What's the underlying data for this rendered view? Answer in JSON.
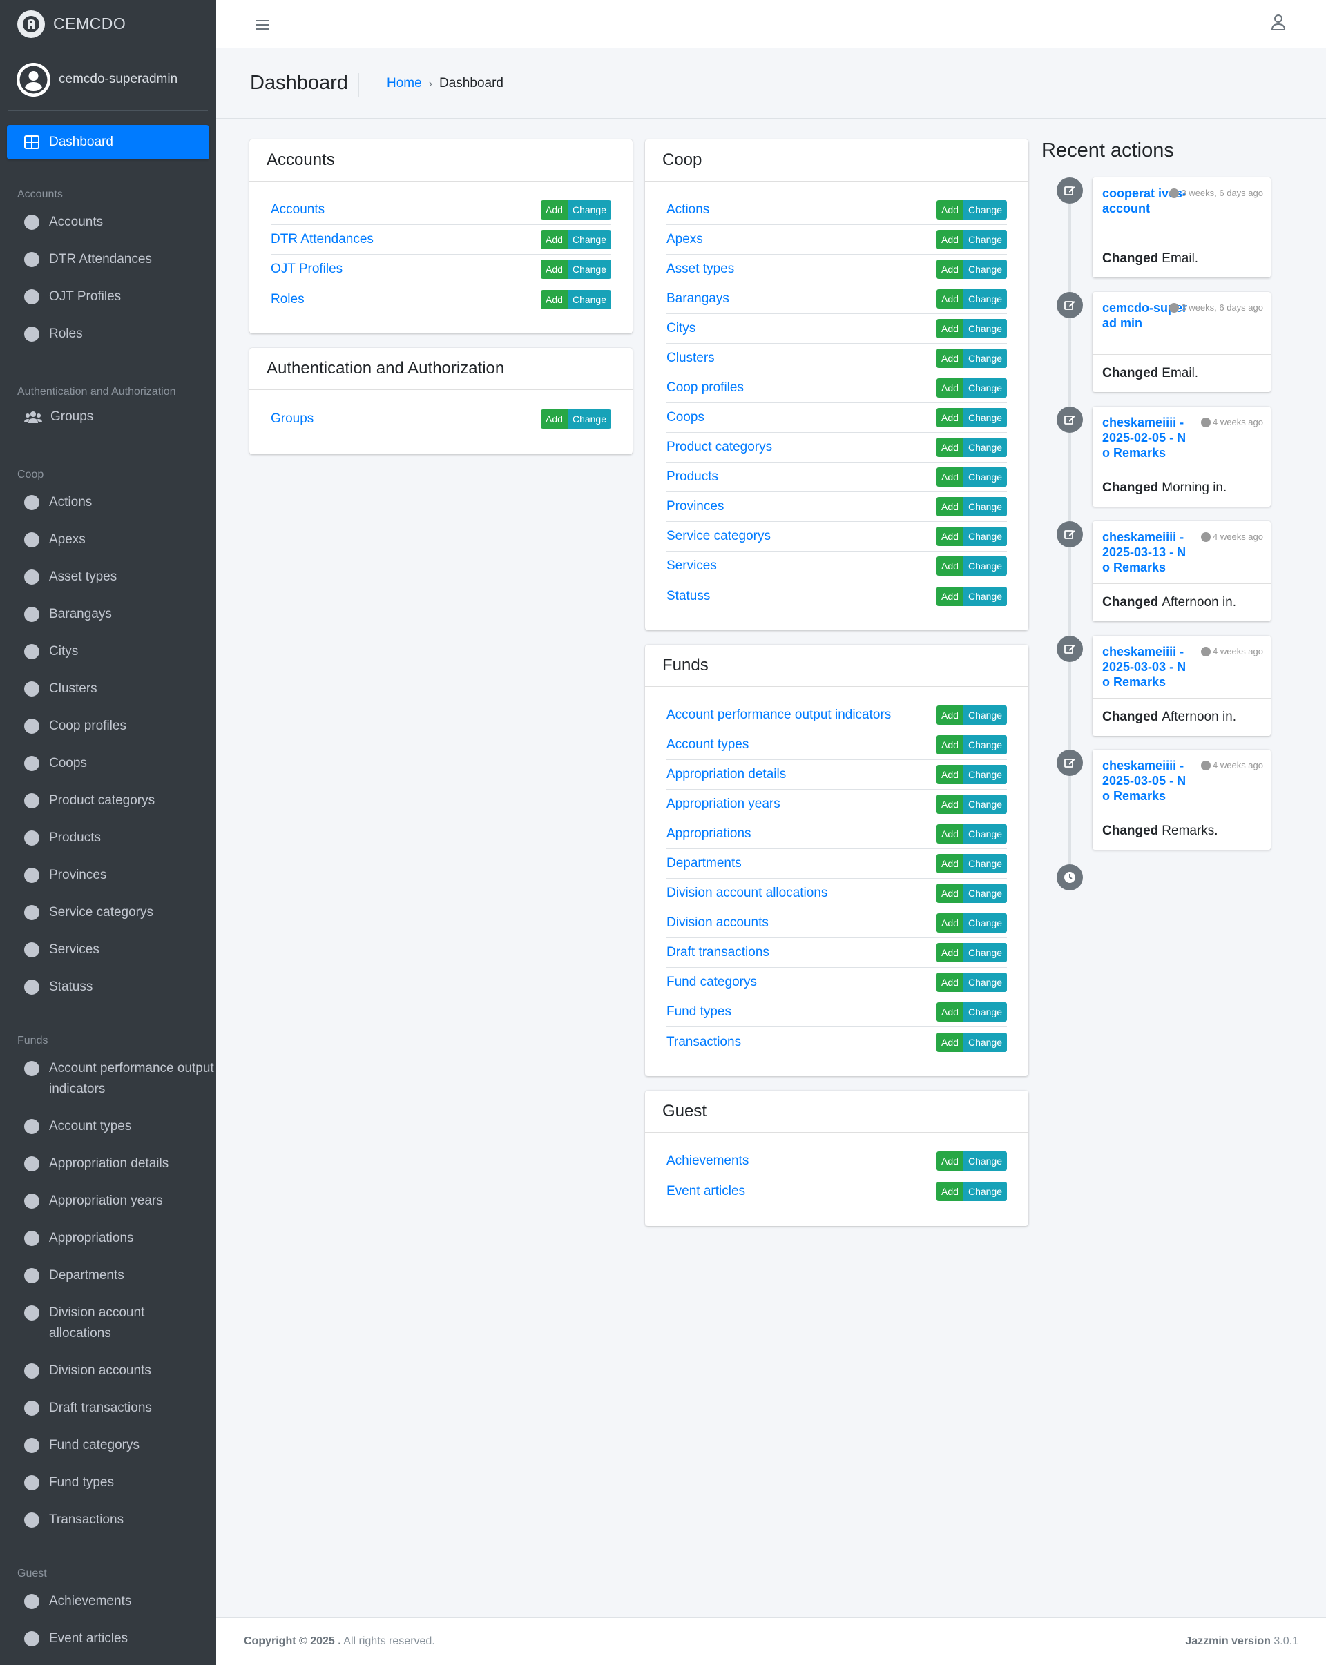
{
  "brand": {
    "name": "CEMCDO"
  },
  "user": {
    "name": "cemcdo-superadmin"
  },
  "sidebar": {
    "dashboard": "Dashboard",
    "accounts_header": "Accounts",
    "accounts": [
      "Accounts",
      "DTR Attendances",
      "OJT Profiles",
      "Roles"
    ],
    "auth_header": "Authentication and Authorization",
    "auth": [
      "Groups"
    ],
    "coop_header": "Coop",
    "coop": [
      "Actions",
      "Apexs",
      "Asset types",
      "Barangays",
      "Citys",
      "Clusters",
      "Coop profiles",
      "Coops",
      "Product categorys",
      "Products",
      "Provinces",
      "Service categorys",
      "Services",
      "Statuss"
    ],
    "funds_header": "Funds",
    "funds": [
      "Account performance output indicators",
      "Account types",
      "Appropriation details",
      "Appropriation years",
      "Appropriations",
      "Departments",
      "Division account allocations",
      "Division accounts",
      "Draft transactions",
      "Fund categorys",
      "Fund types",
      "Transactions"
    ],
    "guest_header": "Guest",
    "guest": [
      "Achievements",
      "Event articles"
    ]
  },
  "header": {
    "title": "Dashboard",
    "breadcrumb_home": "Home",
    "breadcrumb_current": "Dashboard"
  },
  "buttons": {
    "add": "Add",
    "change": "Change"
  },
  "cards": {
    "accounts": {
      "title": "Accounts",
      "models": [
        "Accounts",
        "DTR Attendances",
        "OJT Profiles",
        "Roles"
      ]
    },
    "auth": {
      "title": "Authentication and Authorization",
      "models": [
        "Groups"
      ]
    },
    "coop": {
      "title": "Coop",
      "models": [
        "Actions",
        "Apexs",
        "Asset types",
        "Barangays",
        "Citys",
        "Clusters",
        "Coop profiles",
        "Coops",
        "Product categorys",
        "Products",
        "Provinces",
        "Service categorys",
        "Services",
        "Statuss"
      ]
    },
    "funds": {
      "title": "Funds",
      "models": [
        "Account performance output indicators",
        "Account types",
        "Appropriation details",
        "Appropriation years",
        "Appropriations",
        "Departments",
        "Division account allocations",
        "Division accounts",
        "Draft transactions",
        "Fund categorys",
        "Fund types",
        "Transactions"
      ]
    },
    "guest": {
      "title": "Guest",
      "models": [
        "Achievements",
        "Event articles"
      ]
    }
  },
  "recent": {
    "title": "Recent actions",
    "items": [
      {
        "object": "cooperat ives-account",
        "time": "3 weeks, 6 days ago",
        "verb": "Changed",
        "field": "Email."
      },
      {
        "object": "cemcdo-superad min",
        "time": "3 weeks, 6 days ago",
        "verb": "Changed",
        "field": "Email."
      },
      {
        "object": "cheskameiiii - 2025-02-05 - No Remarks",
        "time": "4 weeks ago",
        "verb": "Changed",
        "field": "Morning in."
      },
      {
        "object": "cheskameiiii - 2025-03-13 - No Remarks",
        "time": "4 weeks ago",
        "verb": "Changed",
        "field": "Afternoon in."
      },
      {
        "object": "cheskameiiii - 2025-03-03 - No Remarks",
        "time": "4 weeks ago",
        "verb": "Changed",
        "field": "Afternoon in."
      },
      {
        "object": "cheskameiiii - 2025-03-05 - No Remarks",
        "time": "4 weeks ago",
        "verb": "Changed",
        "field": "Remarks."
      }
    ]
  },
  "footer": {
    "copyright_bold": "Copyright © 2025 .",
    "copyright_rest": "All rights reserved.",
    "version_label": "Jazzmin version",
    "version": "3.0.1"
  },
  "colors": {
    "primary": "#007bff",
    "success": "#28a745",
    "info": "#17a2b8",
    "sidebar": "#343a40"
  },
  "icons": {
    "menu": "hamburger-icon",
    "user": "user-icon",
    "edit": "edit-icon",
    "clock": "clock-icon"
  }
}
